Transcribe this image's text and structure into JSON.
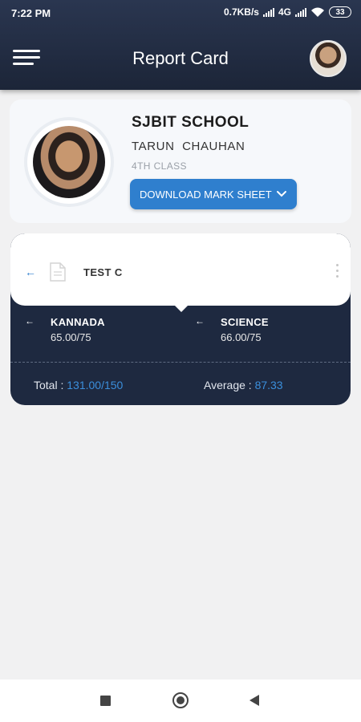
{
  "status_bar": {
    "time": "7:22 PM",
    "speed": "0.7KB/s",
    "network": "4G",
    "battery": "33"
  },
  "app_bar": {
    "title": "Report Card",
    "menu_icon": "hamburger-menu-icon",
    "avatar_icon": "user-avatar"
  },
  "profile": {
    "school": "SJBIT SCHOOL",
    "student": "TARUN  CHAUHAN",
    "class": "4TH CLASS",
    "download_label": "DOWNLOAD MARK SHEET"
  },
  "test": {
    "name": "TEST C",
    "subjects": [
      {
        "name": "KANNADA",
        "marks": "65.00/75"
      },
      {
        "name": "SCIENCE",
        "marks": "66.00/75"
      }
    ],
    "total_label": "Total : ",
    "total_value": "131.00/150",
    "average_label": "Average : ",
    "average_value": "87.33"
  },
  "colors": {
    "header": "#1f2a40",
    "accent": "#2f7fce",
    "card_dark": "#1e2940",
    "background": "#f1f1f2"
  }
}
